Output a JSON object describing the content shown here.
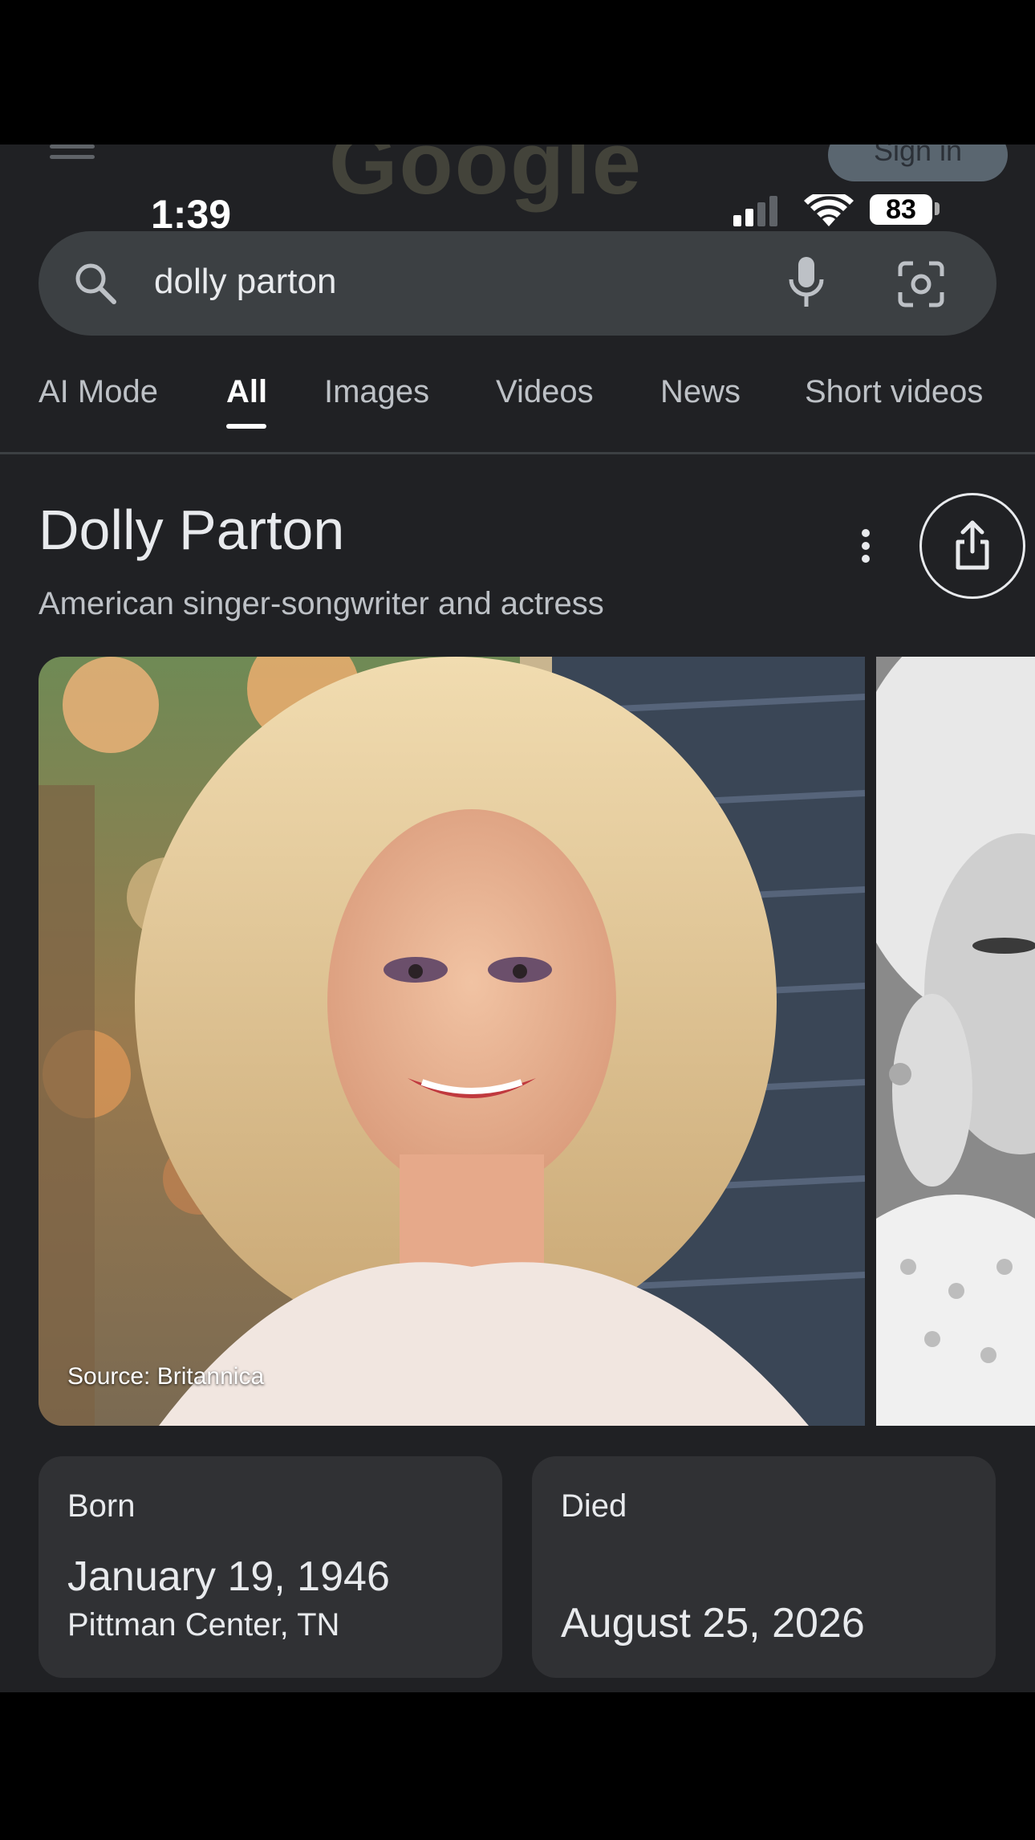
{
  "status_bar": {
    "time": "1:39",
    "battery": "83"
  },
  "header": {
    "logo_text": "Google",
    "signin_label": "Sign in"
  },
  "search": {
    "query": "dolly parton"
  },
  "tabs": [
    {
      "label": "AI Mode",
      "active": false
    },
    {
      "label": "All",
      "active": true
    },
    {
      "label": "Images",
      "active": false
    },
    {
      "label": "Videos",
      "active": false
    },
    {
      "label": "News",
      "active": false
    },
    {
      "label": "Short videos",
      "active": false
    }
  ],
  "knowledge_panel": {
    "title": "Dolly Parton",
    "subtitle": "American singer-songwriter and actress",
    "image_source": "Source: Britannica"
  },
  "facts": {
    "born": {
      "label": "Born",
      "date": "January 19, 1946",
      "place": "Pittman Center, TN"
    },
    "died": {
      "label": "Died",
      "date": "August 25, 2026"
    }
  },
  "colors": {
    "background": "#202124",
    "search_bar": "#3c4043",
    "card": "#303134",
    "text_primary": "#e8eaed",
    "text_secondary": "#bdc1c6"
  },
  "icons": [
    "hamburger-icon",
    "search-icon",
    "mic-icon",
    "lens-icon",
    "more-vert-icon",
    "share-icon",
    "signal-icon",
    "wifi-icon",
    "battery-icon"
  ]
}
